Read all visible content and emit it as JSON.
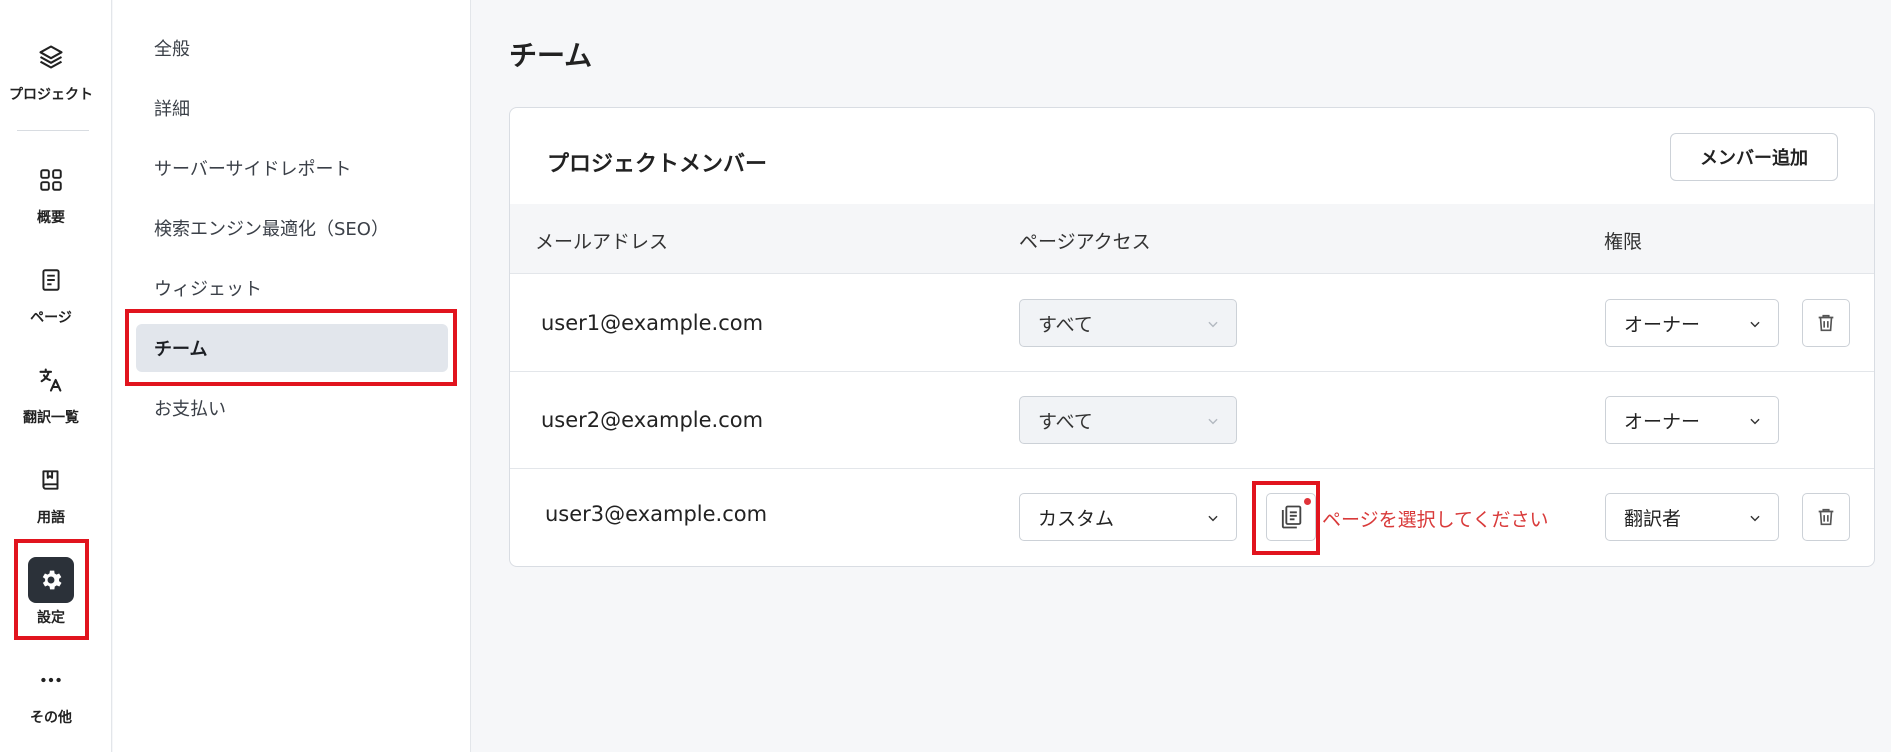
{
  "rail": {
    "items": [
      {
        "label": "プロジェクト",
        "icon": "layers-icon"
      },
      {
        "label": "概要",
        "icon": "grid-icon"
      },
      {
        "label": "ページ",
        "icon": "document-icon"
      },
      {
        "label": "翻訳一覧",
        "icon": "translate-icon"
      },
      {
        "label": "用語",
        "icon": "book-icon"
      },
      {
        "label": "設定",
        "icon": "gear-icon"
      },
      {
        "label": "その他",
        "icon": "more-icon"
      }
    ]
  },
  "submenu": {
    "items": [
      {
        "label": "全般"
      },
      {
        "label": "詳細"
      },
      {
        "label": "サーバーサイドレポート"
      },
      {
        "label": "検索エンジン最適化（SEO）"
      },
      {
        "label": "ウィジェット"
      },
      {
        "label": "チーム"
      },
      {
        "label": "お支払い"
      }
    ],
    "active": "チーム"
  },
  "page": {
    "title": "チーム"
  },
  "members": {
    "title": "プロジェクトメンバー",
    "add_button": "メンバー追加",
    "columns": [
      "メールアドレス",
      "ページアクセス",
      "権限"
    ],
    "rows": [
      {
        "email": "user1@example.com",
        "access": "すべて",
        "role": "オーナー",
        "deletable": true
      },
      {
        "email": "user2@example.com",
        "access": "すべて",
        "role": "オーナー",
        "deletable": false
      },
      {
        "email": "user3@example.com",
        "access": "カスタム",
        "role": "翻訳者",
        "deletable": true,
        "error": "ページを選択してください"
      }
    ]
  },
  "colors": {
    "highlight": "#e1141e",
    "error": "#d93a3a",
    "active_rail": "#2b3139"
  }
}
